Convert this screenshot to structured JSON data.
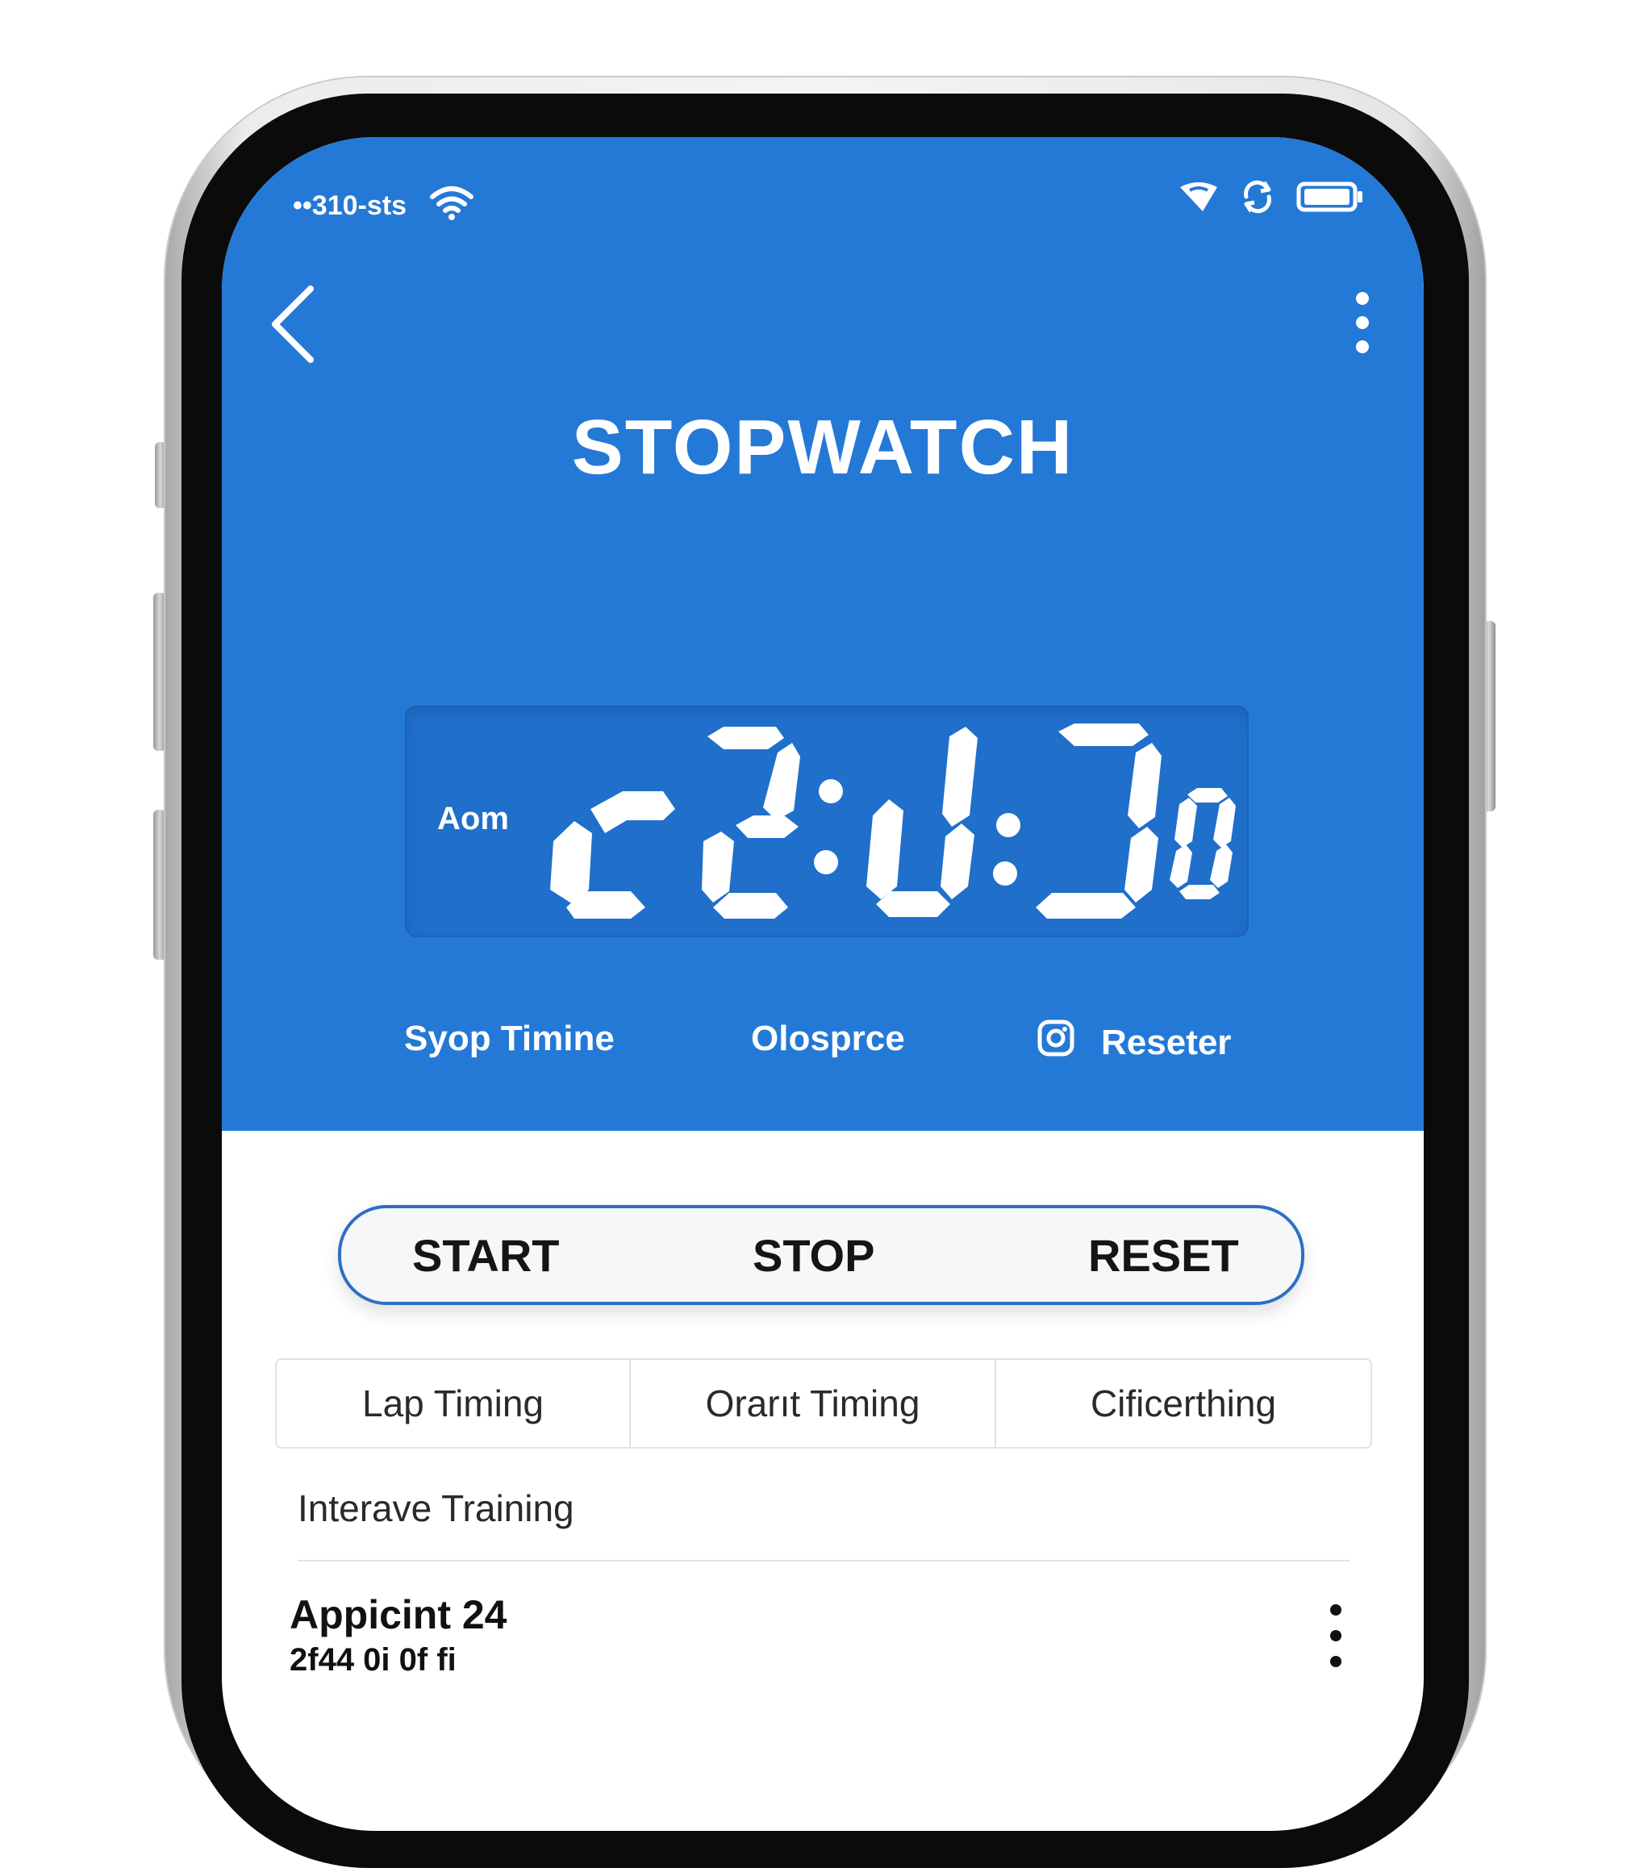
{
  "status_bar": {
    "carrier_text": "••310-sts",
    "wifi_icon": "wifi-icon",
    "signal_icon": "signal-icon",
    "sync_icon": "sync-icon",
    "battery_icon": "battery-icon"
  },
  "nav": {
    "back_icon": "chevron-left-icon",
    "more_icon": "more-vertical-icon"
  },
  "title": "STOPWATCH",
  "display": {
    "label": "Aom",
    "time_readout": "c2:u:J0"
  },
  "modes": [
    {
      "label": "Syop Timine"
    },
    {
      "label": "Olosprce"
    },
    {
      "label": "Reseter",
      "icon": "camera-icon"
    }
  ],
  "controls": {
    "start": "START",
    "stop": "STOP",
    "reset": "RESET"
  },
  "tabs": [
    {
      "label": "Lap Timing"
    },
    {
      "label": "Orarıt Timing"
    },
    {
      "label": "Cificerthing"
    }
  ],
  "section_heading": "Interave Training",
  "list": [
    {
      "title": "Appicint 24",
      "subtitle": "2f44 0i  0f fi"
    }
  ],
  "colors": {
    "header_blue": "#2479d6",
    "display_blue": "#1f6fcb",
    "control_border": "#2d6fc4"
  }
}
